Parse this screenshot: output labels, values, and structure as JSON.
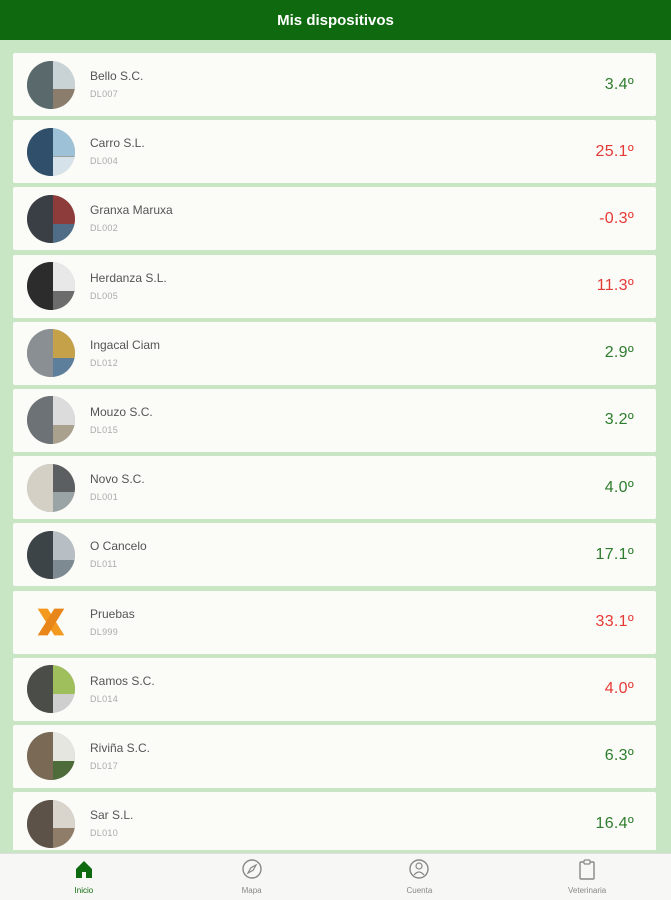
{
  "header": {
    "title": "Mis dispositivos"
  },
  "devices": [
    {
      "name": "Bello S.C.",
      "code": "DL007",
      "temp": "3.4º",
      "status": "ok",
      "colors": [
        "#5a6a6c",
        "#c9d3d6",
        "#8b7d6b"
      ]
    },
    {
      "name": "Carro S.L.",
      "code": "DL004",
      "temp": "25.1º",
      "status": "alert",
      "colors": [
        "#2f4f6a",
        "#9dc2d8",
        "#d6e2ea"
      ]
    },
    {
      "name": "Granxa Maruxa",
      "code": "DL002",
      "temp": "-0.3º",
      "status": "alert",
      "colors": [
        "#3a3f45",
        "#8e3b3b",
        "#4f6d86"
      ]
    },
    {
      "name": "Herdanza S.L.",
      "code": "DL005",
      "temp": "11.3º",
      "status": "alert",
      "colors": [
        "#2c2c2c",
        "#e8e8e8",
        "#6c6c6c"
      ]
    },
    {
      "name": "Ingacal Ciam",
      "code": "DL012",
      "temp": "2.9º",
      "status": "ok",
      "colors": [
        "#8a8f93",
        "#c5a24a",
        "#5e7f9c"
      ]
    },
    {
      "name": "Mouzo S.C.",
      "code": "DL015",
      "temp": "3.2º",
      "status": "ok",
      "colors": [
        "#6d7276",
        "#dcdcdc",
        "#a9a08e"
      ]
    },
    {
      "name": "Novo S.C.",
      "code": "DL001",
      "temp": "4.0º",
      "status": "ok",
      "colors": [
        "#d4d0c6",
        "#5b5f61",
        "#9aa3a6"
      ]
    },
    {
      "name": "O Cancelo",
      "code": "DL011",
      "temp": "17.1º",
      "status": "ok",
      "colors": [
        "#3d4448",
        "#b7bfc4",
        "#7d8a91"
      ]
    },
    {
      "name": "Pruebas",
      "code": "DL999",
      "temp": "33.1º",
      "status": "alert",
      "logo": true
    },
    {
      "name": "Ramos S.C.",
      "code": "DL014",
      "temp": "4.0º",
      "status": "alert",
      "colors": [
        "#4a4d48",
        "#9fbf5c",
        "#cfcfcf"
      ]
    },
    {
      "name": "Riviña S.C.",
      "code": "DL017",
      "temp": "6.3º",
      "status": "ok",
      "colors": [
        "#7a6a55",
        "#e6e6e0",
        "#4e6b3a"
      ]
    },
    {
      "name": "Sar S.L.",
      "code": "DL010",
      "temp": "16.4º",
      "status": "ok",
      "colors": [
        "#5c5248",
        "#d9d4cc",
        "#8f7c69"
      ]
    }
  ],
  "nav": [
    {
      "label": "Inicio",
      "icon": "home-icon",
      "active": true
    },
    {
      "label": "Mapa",
      "icon": "compass-icon",
      "active": false
    },
    {
      "label": "Cuenta",
      "icon": "account-icon",
      "active": false
    },
    {
      "label": "Veterinaria",
      "icon": "clipboard-icon",
      "active": false
    }
  ],
  "colors": {
    "header": "#0f6a0f",
    "ok": "#2e7d2e",
    "alert": "#e53935",
    "background": "#c8e6c4"
  }
}
